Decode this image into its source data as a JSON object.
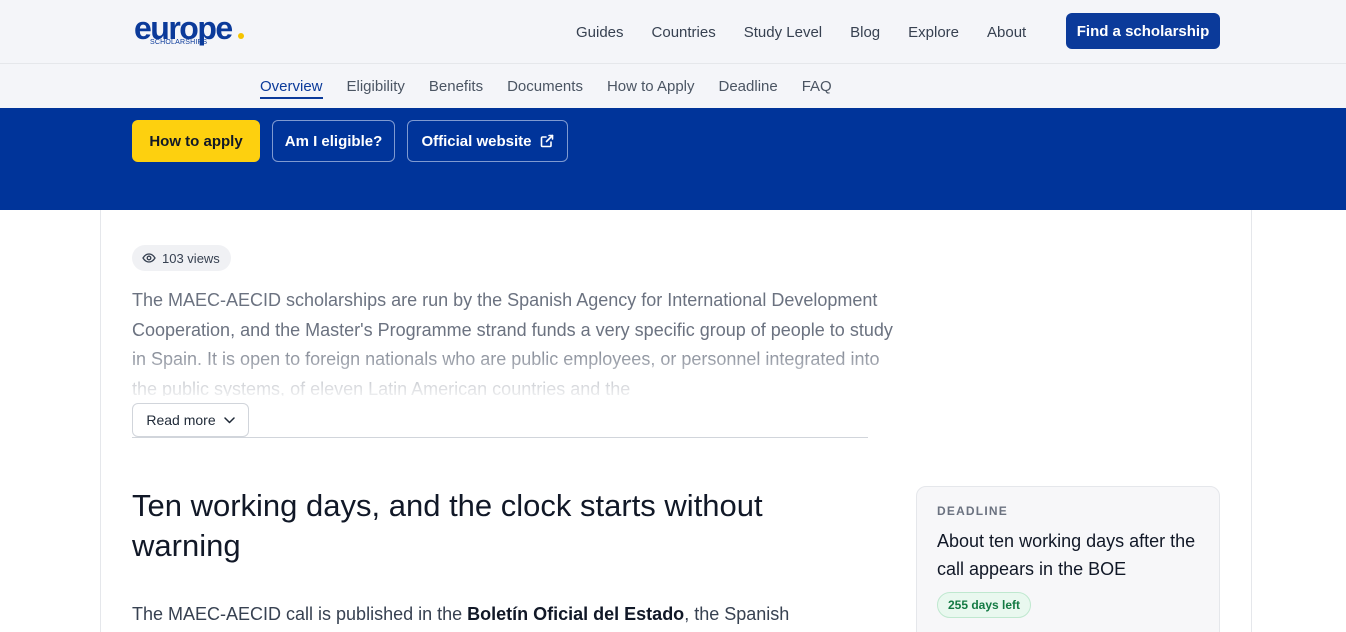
{
  "header": {
    "logo_text": "europe",
    "logo_subtext": "SCHOLARSHIPS",
    "nav": [
      "Guides",
      "Countries",
      "Study Level",
      "Blog",
      "Explore",
      "About"
    ],
    "cta": "Find a scholarship"
  },
  "subnav": {
    "items": [
      "Overview",
      "Eligibility",
      "Benefits",
      "Documents",
      "How to Apply",
      "Deadline",
      "FAQ"
    ],
    "active": "Overview"
  },
  "actions": {
    "apply": "How to apply",
    "eligible": "Am I eligible?",
    "website": "Official website"
  },
  "content": {
    "views": "103 views",
    "intro": "The MAEC-AECID scholarships are run by the Spanish Agency for International Development Cooperation, and the Master's Programme strand funds a very specific group of people to study in Spain. It is open to foreign nationals who are public employees, or personnel integrated into the public systems, of eleven Latin American countries and the",
    "read_more": "Read more",
    "heading": "Ten working days, and the clock starts without warning",
    "para_prefix": "The MAEC-AECID call is published in the ",
    "para_bold": "Boletín Oficial del Estado",
    "para_suffix": ", the Spanish"
  },
  "deadline": {
    "label": "DEADLINE",
    "text": "About ten working days after the call appears in the BOE",
    "badge": "255 days left"
  },
  "colors": {
    "brand_blue": "#00349a",
    "accent_yellow": "#fdd00f",
    "badge_green": "#137a43"
  }
}
